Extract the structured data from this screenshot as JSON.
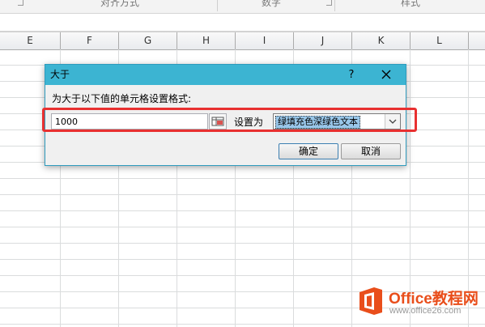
{
  "ribbon": {
    "groups": [
      {
        "label": "对齐方式"
      },
      {
        "label": "数字"
      },
      {
        "label": "样式"
      }
    ]
  },
  "columns": [
    "E",
    "F",
    "G",
    "H",
    "I",
    "J",
    "K",
    "L"
  ],
  "dialog": {
    "title": "大于",
    "help_label": "?",
    "prompt": "为大于以下值的单元格设置格式:",
    "value": "1000",
    "set_as_label": "设置为",
    "format_selected": "绿填充色深绿色文本",
    "ok_label": "确定",
    "cancel_label": "取消"
  },
  "colors": {
    "titlebar": "#3cb4d2",
    "highlight": "#e83030",
    "watermark_orange": "#e94e1b"
  },
  "watermark": {
    "title": "Office教程网",
    "url": "www.office26.com"
  }
}
